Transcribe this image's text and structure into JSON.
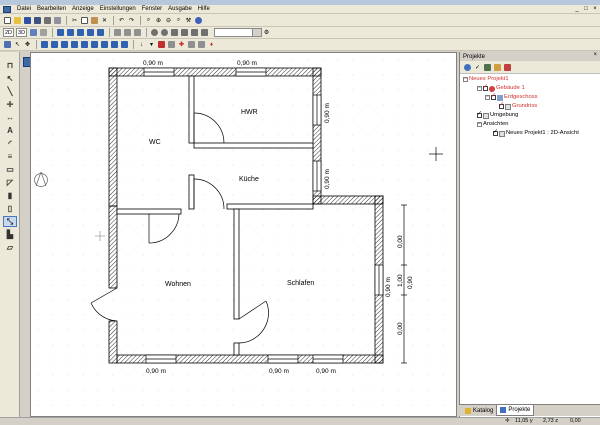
{
  "menu": [
    "Datei",
    "Bearbeiten",
    "Anzeige",
    "Einstellungen",
    "Fenster",
    "Ausgabe",
    "Hilfe"
  ],
  "window_controls": [
    "_",
    "□",
    "×"
  ],
  "toolbar2": {
    "label_2d": "2D",
    "label_3d": "3D"
  },
  "floorplan": {
    "rooms": {
      "hwr": "HWR",
      "wc": "WC",
      "kueche": "Küche",
      "wohnen": "Wohnen",
      "schlafen": "Schlafen"
    },
    "dimensions": {
      "wc_top": "0,90 m",
      "hwr_top": "0,90 m",
      "hwr_right": "0,90 m",
      "kueche_right": "0,90 m",
      "schlafen_right": "0,90 m",
      "wohnen_bottom": "0,90 m",
      "schlafen_bottom_1": "0,90 m",
      "schlafen_bottom_2": "0,90 m",
      "dim_a": "0,00",
      "dim_b": "1,00",
      "dim_c": "0,90",
      "dim_d": "0,00"
    }
  },
  "panel": {
    "title": "Projekte",
    "close": "×",
    "tree": {
      "project": "Neues Projekt1",
      "building": "Gebäude 1",
      "floor": "Erdgeschoss",
      "plan": "Grundriss",
      "surroundings": "Umgebung",
      "views": "Ansichten",
      "view_item": "Neues Projekt1 : 2D-Ansicht"
    },
    "tabs": [
      "Katalog",
      "Projekte"
    ]
  },
  "status": {
    "pos1": "11,05 y",
    "pos2": "2,73 z",
    "pos3": "0,00"
  },
  "colors": {
    "accent": "#3c6aa8",
    "tree_red": "#d03030",
    "wall_hatch": "#000000"
  }
}
